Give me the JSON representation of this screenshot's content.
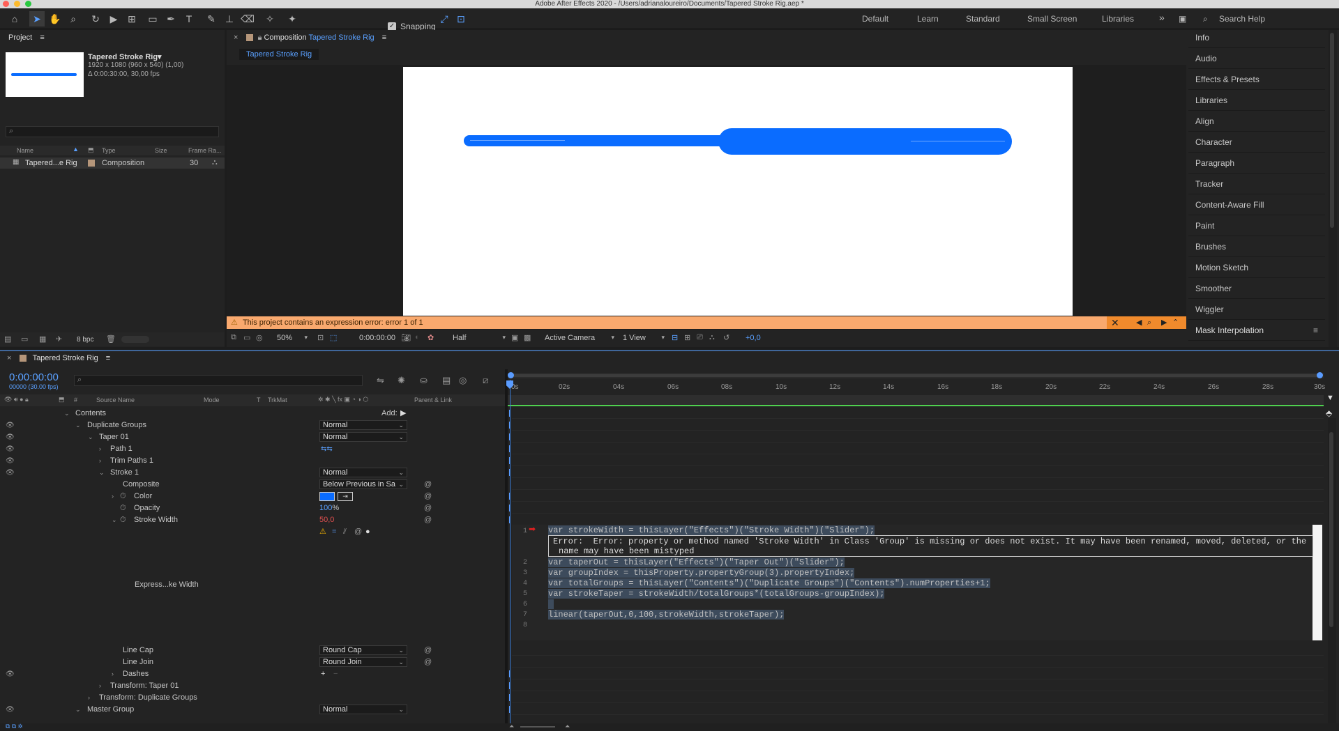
{
  "window": {
    "title": "Adobe After Effects 2020 - /Users/adrianaloureiro/Documents/Tapered Stroke Rig.aep *"
  },
  "toolbar": {
    "snapping": "Snapping",
    "workspaces": [
      "Default",
      "Learn",
      "Standard",
      "Small Screen",
      "Libraries"
    ],
    "search_placeholder": "Search Help",
    "more": "»"
  },
  "project": {
    "panel_title": "Project",
    "comp_name": "Tapered Stroke Rig",
    "comp_name_arrow": "▾",
    "dims": "1920 x 1080  (960 x 540) (1,00)",
    "duration": "Δ 0:00:30:00, 30,00 fps",
    "columns": [
      "Name",
      "Type",
      "Size",
      "Frame Ra..."
    ],
    "items": [
      {
        "name": "Tapered...e Rig",
        "type": "Composition",
        "frame_rate": "30"
      }
    ],
    "bpc": "8 bpc"
  },
  "comp": {
    "panel_label": "Composition",
    "comp_link": "Tapered Stroke Rig",
    "tab": "Tapered Stroke Rig",
    "error": "This project contains an expression error: error 1 of 1",
    "zoom": "50%",
    "time": "0:00:00:00",
    "resolution": "Half",
    "camera": "Active Camera",
    "views": "1 View",
    "exposure": "+0,0",
    "stroke_color": "#0a6cff"
  },
  "right_panels": [
    "Info",
    "Audio",
    "Effects & Presets",
    "Libraries",
    "Align",
    "Character",
    "Paragraph",
    "Tracker",
    "Content-Aware Fill",
    "Paint",
    "Brushes",
    "Motion Sketch",
    "Smoother",
    "Wiggler",
    "Mask Interpolation"
  ],
  "timeline": {
    "tab": "Tapered Stroke Rig",
    "timecode": "0:00:00:00",
    "frames": "00000 (30.00 fps)",
    "columns": [
      "#",
      "Source Name",
      "Mode",
      "T",
      "TrkMat",
      "Parent & Link"
    ],
    "add_label": "Add:",
    "rows": [
      {
        "label": "Contents"
      },
      {
        "label": "Duplicate Groups",
        "mode": "Normal"
      },
      {
        "label": "Taper 01",
        "mode": "Normal"
      },
      {
        "label": "Path 1"
      },
      {
        "label": "Trim Paths 1"
      },
      {
        "label": "Stroke 1",
        "mode": "Normal"
      },
      {
        "label": "Composite",
        "mode": "Below Previous in Sa"
      },
      {
        "label": "Color"
      },
      {
        "label": "Opacity",
        "value_blue": "100",
        "value_rest": "%"
      },
      {
        "label": "Stroke Width",
        "value": "50,0"
      }
    ],
    "expr_label": "Express...ke Width",
    "rows2": [
      {
        "label": "Line Cap",
        "mode": "Round Cap"
      },
      {
        "label": "Line Join",
        "mode": "Round Join"
      },
      {
        "label": "Dashes"
      },
      {
        "label": "Transform: Taper 01"
      },
      {
        "label": "Transform: Duplicate Groups"
      },
      {
        "label": "Master Group",
        "mode": "Normal"
      }
    ],
    "ruler": [
      "0s",
      "02s",
      "04s",
      "06s",
      "08s",
      "10s",
      "12s",
      "14s",
      "16s",
      "18s",
      "20s",
      "22s",
      "24s",
      "26s",
      "28s",
      "30s"
    ],
    "expression": {
      "line_numbers": [
        "1",
        "2",
        "3",
        "4",
        "5",
        "6",
        "7",
        "8"
      ],
      "lines": [
        "var strokeWidth = thisLayer(\"Effects\")(\"Stroke Width\")(\"Slider\");",
        "var taperOut = thisLayer(\"Effects\")(\"Taper Out\")(\"Slider\");",
        "var groupIndex = thisProperty.propertyGroup(3).propertyIndex;",
        "var totalGroups = thisLayer(\"Contents\")(\"Duplicate Groups\")(\"Contents\").numProperties+1;",
        "var strokeTaper = strokeWidth/totalGroups*(totalGroups-groupIndex);",
        "",
        "linear(taperOut,0,100,strokeWidth,strokeTaper);",
        ""
      ],
      "error_line1": "Error:  Error: property or method named 'Stroke Width' in Class 'Group' is missing or does not exist. It may have been renamed, moved, deleted, or the",
      "error_line2": "name may have been mistyped"
    }
  }
}
